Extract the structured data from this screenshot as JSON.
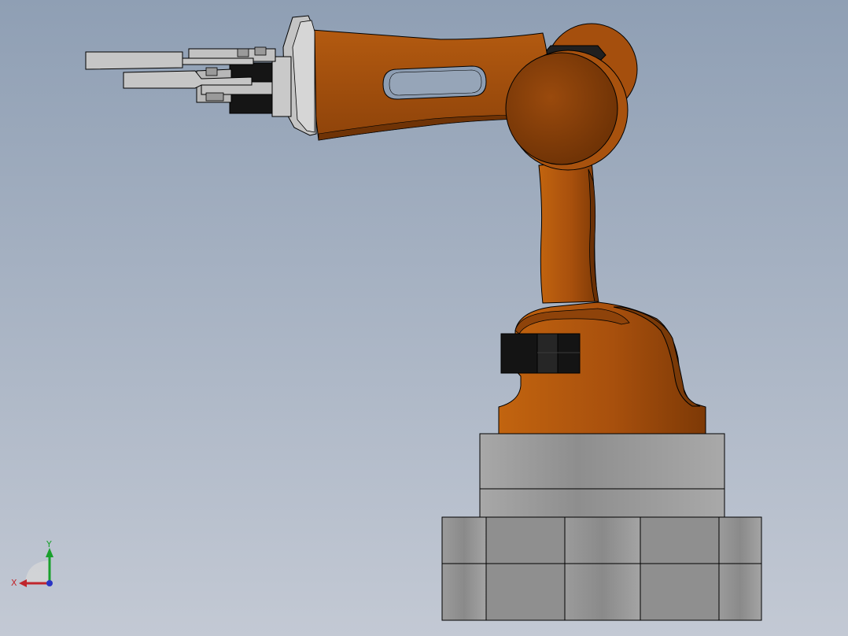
{
  "viewport": {
    "background_top": "#8f9fb4",
    "background_bottom": "#c3c9d4"
  },
  "robot": {
    "body_color": "#b2550f",
    "body_shadow": "#7d3906",
    "body_highlight": "#c96a1c",
    "base_color": "#a3a3a3",
    "base_dark": "#7e7e7e",
    "gripper_color": "#bdbdbd",
    "servo_color": "#161616"
  },
  "triad": {
    "x_label": "X",
    "y_label": "Y",
    "x_color": "#c0262d",
    "y_color": "#19a02c",
    "z_color": "#2a34c4"
  }
}
